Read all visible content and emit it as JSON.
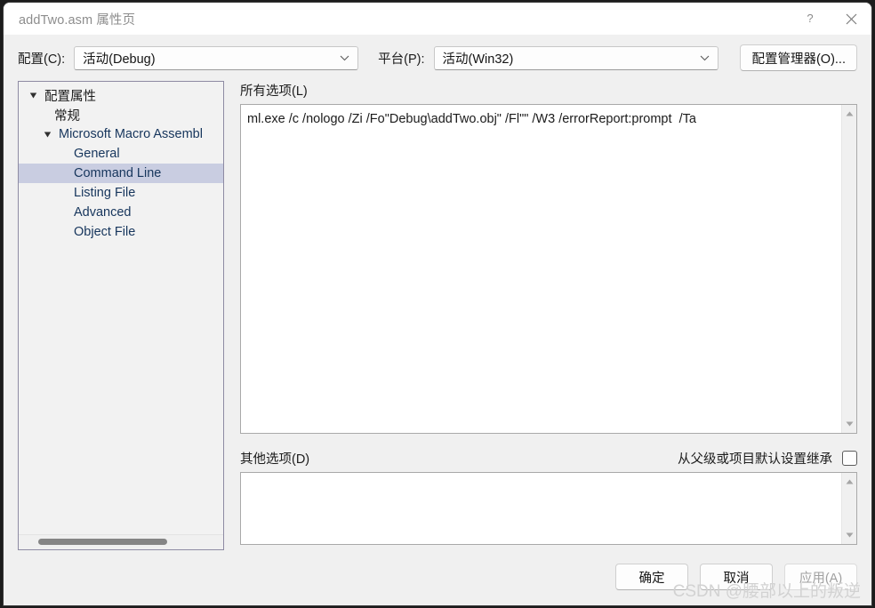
{
  "window": {
    "title": "addTwo.asm 属性页",
    "help_icon": "question-mark-icon",
    "close_icon": "close-icon"
  },
  "config_row": {
    "configuration_label": "配置(C):",
    "configuration_value": "活动(Debug)",
    "platform_label": "平台(P):",
    "platform_value": "活动(Win32)",
    "config_manager_button": "配置管理器(O)..."
  },
  "tree": {
    "items": [
      {
        "label": "配置属性",
        "level": 0,
        "expanded": true,
        "selected": false,
        "lang": "zh"
      },
      {
        "label": "常规",
        "level": 1,
        "expanded": null,
        "selected": false,
        "lang": "zh"
      },
      {
        "label": "Microsoft Macro Assembl",
        "level": 1,
        "expanded": true,
        "selected": false,
        "lang": "en"
      },
      {
        "label": "General",
        "level": 2,
        "expanded": null,
        "selected": false,
        "lang": "en"
      },
      {
        "label": "Command Line",
        "level": 2,
        "expanded": null,
        "selected": true,
        "lang": "en"
      },
      {
        "label": "Listing File",
        "level": 2,
        "expanded": null,
        "selected": false,
        "lang": "en"
      },
      {
        "label": "Advanced",
        "level": 2,
        "expanded": null,
        "selected": false,
        "lang": "en"
      },
      {
        "label": "Object File",
        "level": 2,
        "expanded": null,
        "selected": false,
        "lang": "en"
      }
    ]
  },
  "all_options": {
    "label": "所有选项(L)",
    "value": "ml.exe /c /nologo /Zi /Fo\"Debug\\addTwo.obj\" /Fl\"\" /W3 /errorReport:prompt  /Ta"
  },
  "additional_options": {
    "label": "其他选项(D)",
    "value": "",
    "inherit_label": "从父级或项目默认设置继承",
    "inherit_checked": false
  },
  "footer": {
    "ok_label": "确定",
    "cancel_label": "取消",
    "apply_label": "应用(A)",
    "apply_disabled": true
  },
  "watermark": {
    "text": "CSDN @腰部以上的叛逆"
  },
  "colors": {
    "dialog_bg": "#f0f0f0",
    "titlebar_bg": "#ffffff",
    "tree_selection": "#c9cde1",
    "tree_text": "#16355c",
    "border": "#8e8ba3"
  }
}
